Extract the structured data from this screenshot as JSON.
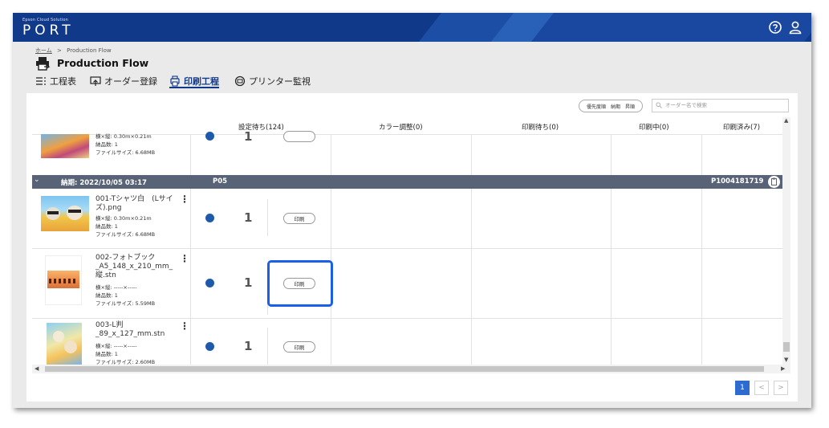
{
  "header": {
    "brand_small": "Epson Cloud Solution",
    "brand_big": "PORT",
    "colors": {
      "bar": "#10398a",
      "accent": "#1a5fe8"
    }
  },
  "breadcrumb": {
    "home": "ホーム",
    "sep": ">",
    "current": "Production Flow"
  },
  "page_title": "Production Flow",
  "tabs": [
    {
      "label": "工程表",
      "icon": "list-icon",
      "active": false
    },
    {
      "label": "オーダー登録",
      "icon": "upload-icon",
      "active": false
    },
    {
      "label": "印刷工程",
      "icon": "printer-icon",
      "active": true
    },
    {
      "label": "プリンター監視",
      "icon": "monitor-icon",
      "active": false
    }
  ],
  "toolbar": {
    "priority_label": "優先度順　納期　昇順",
    "search_placeholder": "オーダー名で検索"
  },
  "columns": [
    "設定待ち(124)",
    "カラー調整(0)",
    "印刷待ち(0)",
    "印刷中(0)",
    "印刷済み(7)"
  ],
  "top_partial": {
    "size": "横×縦: 0.30m×0.21m",
    "qty": "納品数: 1",
    "filesize": "ファイルサイズ: 6.68MB"
  },
  "group": {
    "due": "納期: 2022/10/05 03:17",
    "code": "P05",
    "order_id": "P1004181719"
  },
  "items": [
    {
      "name_l1": "001-Tシャツ白　(Lサイ",
      "name_l2": "ズ).png",
      "name_l3": "",
      "size": "横×縦: 0.30m×0.21m",
      "qty": "納品数: 1",
      "filesize": "ファイルサイズ: 6.68MB",
      "count": "1",
      "print_label": "印刷"
    },
    {
      "name_l1": "002-フォトブック",
      "name_l2": "_A5_148_x_210_mm_",
      "name_l3": "縦.stn",
      "size": "横×縦: -----×-----",
      "qty": "納品数: 1",
      "filesize": "ファイルサイズ: 5.59MB",
      "count": "1",
      "print_label": "印刷"
    },
    {
      "name_l1": "003-L判",
      "name_l2": "_89_x_127_mm.stn",
      "name_l3": "",
      "size": "横×縦: -----×-----",
      "qty": "納品数: 1",
      "filesize": "ファイルサイズ: 2.60MB",
      "count": "1",
      "print_label": "印刷"
    }
  ],
  "pagination": {
    "current": "1",
    "prev": "<",
    "next": ">"
  }
}
